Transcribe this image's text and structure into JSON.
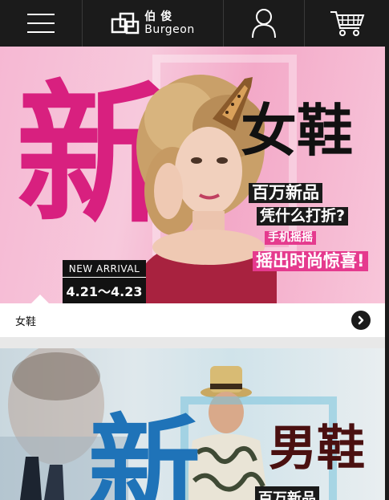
{
  "header": {
    "logo_cn": "伯俊",
    "logo_en": "Burgeon",
    "icons": [
      "menu-icon",
      "brand-logo-icon",
      "user-icon",
      "cart-icon"
    ]
  },
  "banner1": {
    "big_char": "新",
    "title": "女鞋",
    "lines": [
      "百万新品",
      "凭什么打折?",
      "手机摇摇",
      "摇出时尚惊喜!"
    ],
    "arrival_label": "NEW ARRIVAL",
    "dates": "4.21～4.23",
    "colors": {
      "accent": "#d8207f",
      "background": "#f6b8d3"
    }
  },
  "caption1": {
    "label": "女鞋",
    "icon": "chevron-right-icon"
  },
  "banner2": {
    "big_char": "新",
    "title": "男鞋",
    "subtitle": "百万新品",
    "colors": {
      "accent": "#1f73b8",
      "title": "#4a1010"
    }
  }
}
